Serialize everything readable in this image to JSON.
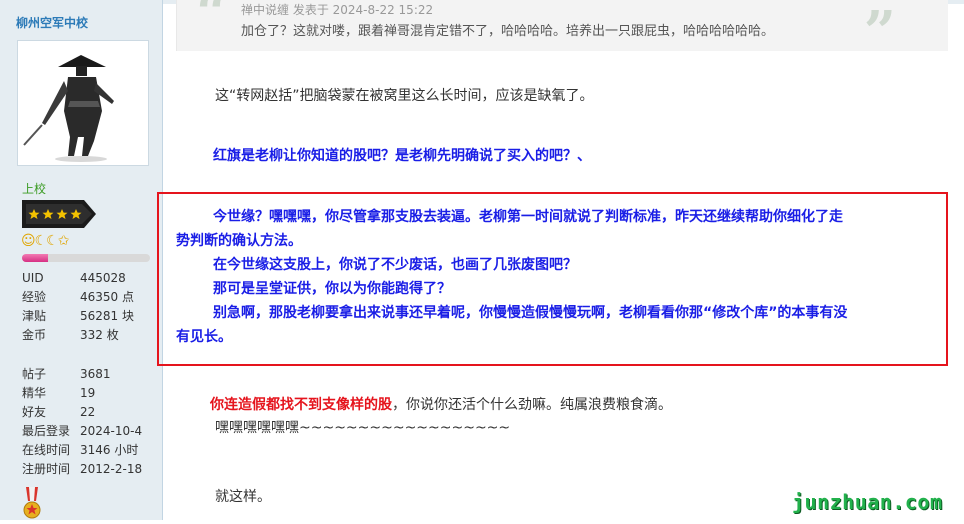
{
  "user": {
    "name": "柳州空军中校",
    "rank": "上校",
    "rank_icons": "☺☾☾✩",
    "xp_progress": 0.2,
    "stats_a": [
      {
        "label": "UID",
        "value": "445028"
      },
      {
        "label": "经验",
        "value": "46350 点"
      },
      {
        "label": "津贴",
        "value": "56281 块"
      },
      {
        "label": "金币",
        "value": "332 枚"
      }
    ],
    "stats_b": [
      {
        "label": "帖子",
        "value": "3681"
      },
      {
        "label": "精华",
        "value": "19"
      },
      {
        "label": "好友",
        "value": "22"
      },
      {
        "label": "最后登录",
        "value": "2024-10-4"
      },
      {
        "label": "在线时间",
        "value": "3146 小时"
      },
      {
        "label": "注册时间",
        "value": "2012-2-18"
      }
    ]
  },
  "quote": {
    "meta": "禅中说缠 发表于 2024-8-22 15:22",
    "text": "加仓了？这就对喽，跟着禅哥混肯定错不了，哈哈哈哈。培养出一只跟屁虫，哈哈哈哈哈哈。"
  },
  "post": {
    "para1": "这“转网赵括”把脑袋蒙在被窝里这么长时间，应该是缺氧了。",
    "para2": "红旗是老柳让你知道的股吧？是老柳先明确说了买入的吧？、",
    "box_lines": [
      "今世缘？嘿嘿嘿，你尽管拿那支股去装逼。老柳第一时间就说了判断标准，昨天还继续帮助你细化了走",
      "势判断的确认方法。",
      "在今世缘这支股上，你说了不少废话，也画了几张废图吧？",
      "那可是呈堂证供，你以为你能跑得了？",
      "别急啊，那股老柳要拿出来说事还早着呢，你慢慢造假慢慢玩啊，老柳看看你那“修改个库”的本事有没",
      "有见长。"
    ],
    "para4_red": "你连造假都找不到支像样的股",
    "para4_rest": "，你说你还活个什么劲嘛。纯属浪费粮食滴。",
    "para5": "嘿嘿嘿嘿嘿嘿~~~~~~~~~~~~~~~~~~",
    "para6": "就这样。"
  },
  "watermark": "junzhuan.com",
  "colors": {
    "blue_text": "#1a1ee6",
    "red_text": "#e5141d",
    "username": "#2d7bb8",
    "rank": "#3a9b23",
    "watermark": "#22b14c"
  }
}
